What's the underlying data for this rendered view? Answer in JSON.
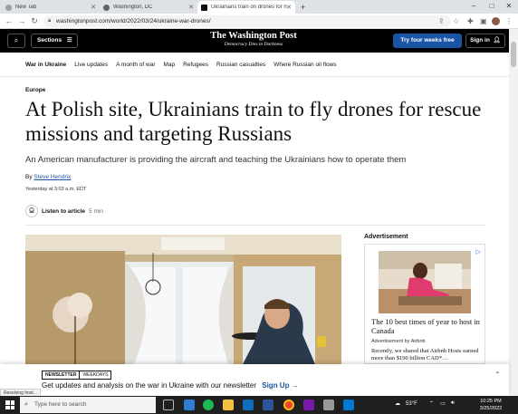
{
  "browser": {
    "tabs": [
      {
        "label": "New Tab",
        "active": false
      },
      {
        "label": "Washington, DC",
        "active": false
      },
      {
        "label": "Ukrainians train on drones for n",
        "active": true
      }
    ],
    "new_tab_symbol": "+",
    "url": "washingtonpost.com/world/2022/03/24/ukraine-war-drones/",
    "window_controls": {
      "minimize": "–",
      "maximize": "□",
      "close": "✕"
    }
  },
  "site_header": {
    "sections_label": "Sections",
    "logo_name": "The Washington Post",
    "logo_tagline": "Democracy Dies in Darkness",
    "subscribe_label": "Try four weeks free",
    "signin_label": "Sign in"
  },
  "subnav": {
    "items": [
      "War in Ukraine",
      "Live updates",
      "A month of war",
      "Map",
      "Refugees",
      "Russian casualties",
      "Where Russian oil flows"
    ]
  },
  "article": {
    "kicker": "Europe",
    "headline": "At Polish site, Ukrainians train to fly drones for rescue missions and targeting Russians",
    "dek": "An American manufacturer is providing the aircraft and teaching the Ukrainians how to operate them",
    "byline_prefix": "By",
    "author": "Steve Hendrix",
    "timestamp": "Yesterday at 3:03 a.m. EDT",
    "listen_label": "Listen to article",
    "listen_duration": "5 min"
  },
  "ad": {
    "label": "Advertisement",
    "title": "The 10 best times of year to host in Canada",
    "sponsor": "Advertisement by Airbnb",
    "body": "Recently, we shared that Airbnb Hosts earned more than $190 billion CAD*…"
  },
  "newsletter": {
    "badge_left": "NEWSLETTER",
    "badge_right": "WEEKDAYS",
    "text": "Get updates and analysis on the war in Ukraine with our newsletter",
    "cta": "Sign Up →"
  },
  "status_text": "Resolving host...",
  "taskbar": {
    "search_placeholder": "Type here to search",
    "weather": "53°F",
    "time": "10:25 PM",
    "date": "3/25/2022"
  },
  "colors": {
    "brand_blue": "#1955a5",
    "header_black": "#000000"
  }
}
